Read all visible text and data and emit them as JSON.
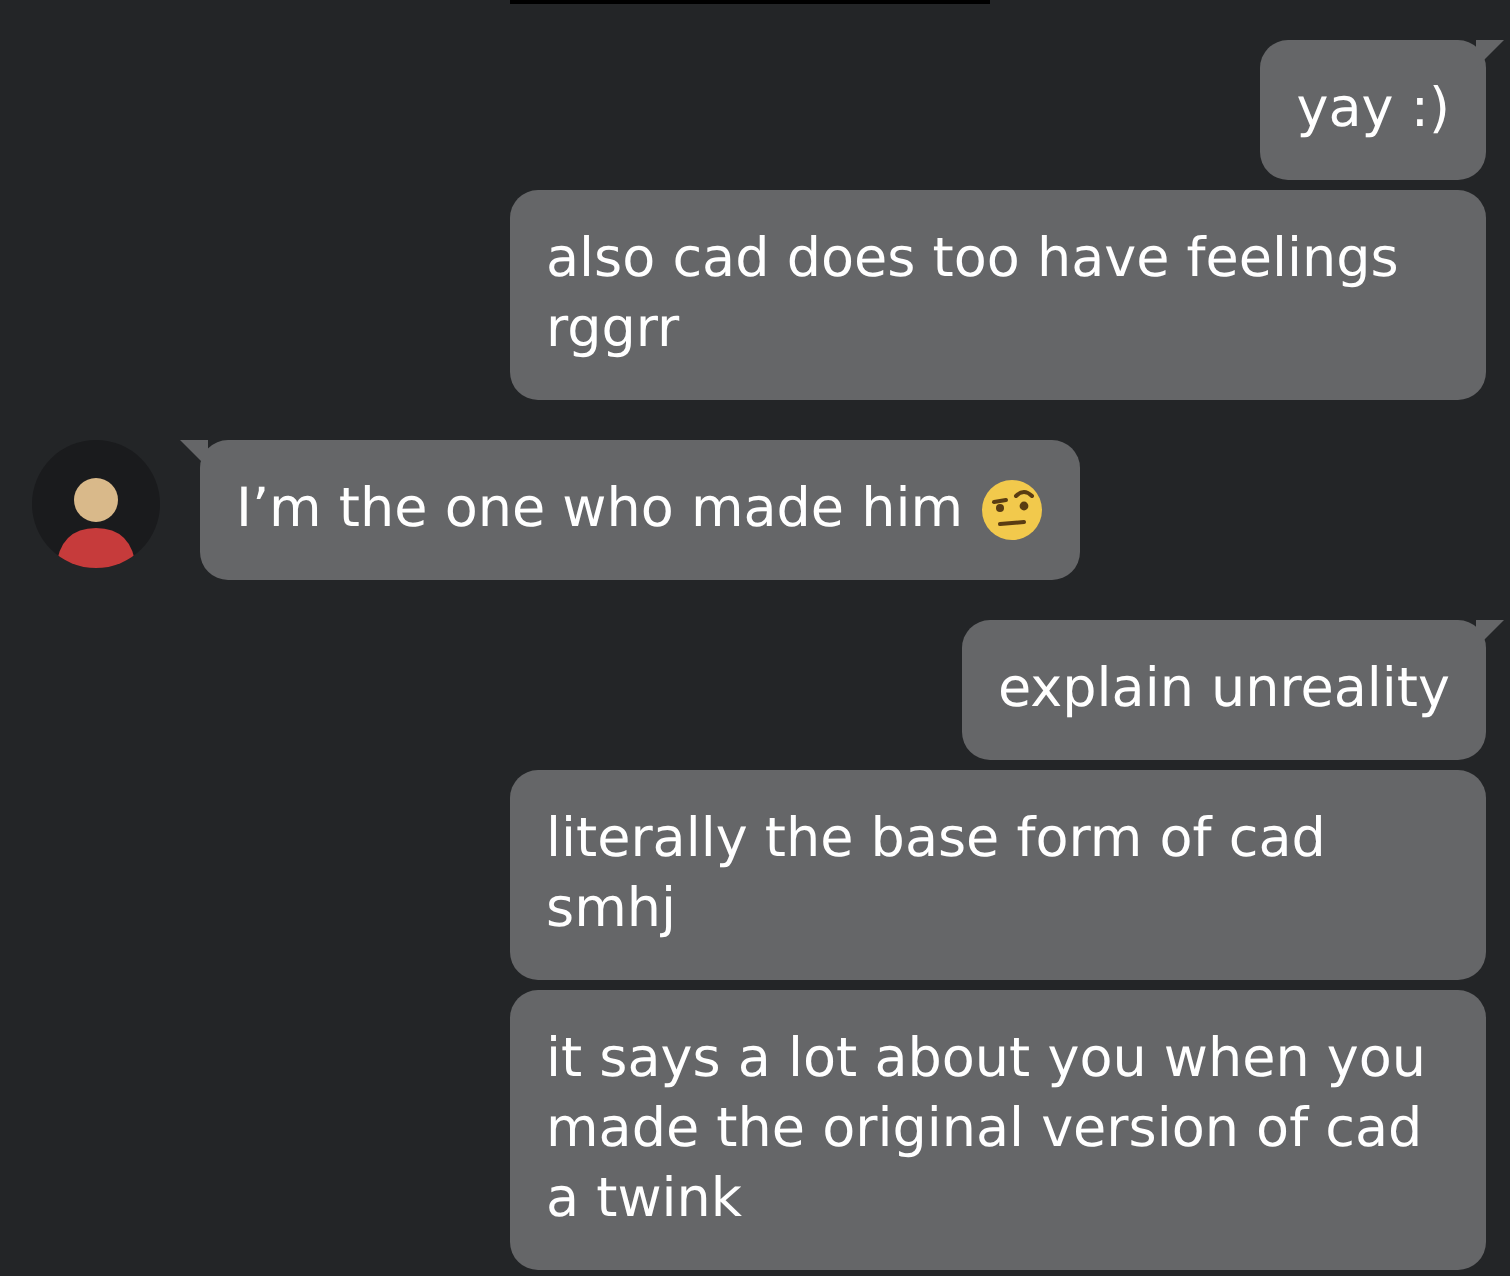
{
  "messages": [
    {
      "kind": "outgoing",
      "text": "yay :)",
      "tail": true
    },
    {
      "kind": "outgoing",
      "text": "also cad does too have feelings rggrr",
      "tail": false
    },
    {
      "kind": "incoming",
      "text": "I’m the one who made him",
      "tail": true,
      "emoji": true
    },
    {
      "kind": "outgoing",
      "text": "explain unreality",
      "tail": true
    },
    {
      "kind": "outgoing",
      "text": "literally the base form of cad smhj",
      "tail": false
    },
    {
      "kind": "outgoing",
      "text": "it says a lot about you when you made the original version of cad a twink",
      "tail": false
    }
  ]
}
